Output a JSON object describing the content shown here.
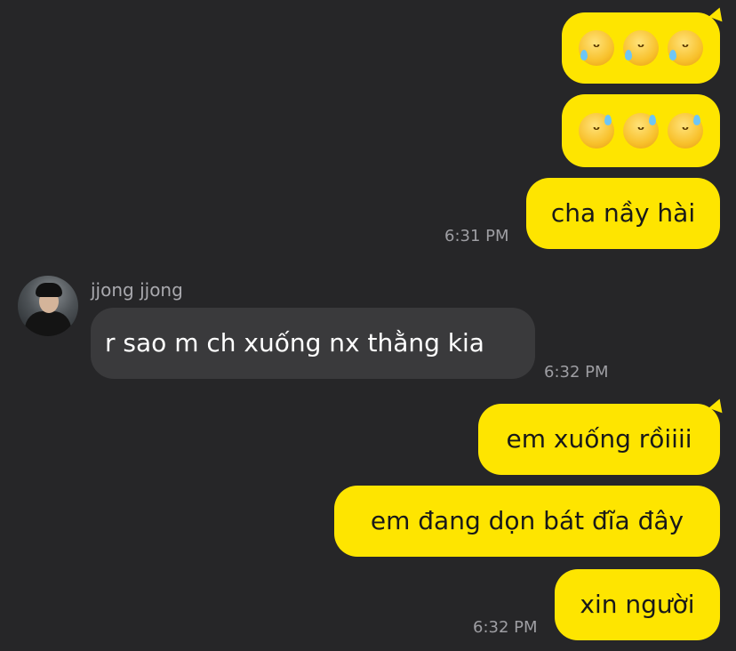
{
  "chat": {
    "outgoing_group_1": {
      "emoji_row_1": [
        "rolling-on-floor-laughing-emoji",
        "rolling-on-floor-laughing-emoji",
        "rolling-on-floor-laughing-emoji"
      ],
      "emoji_row_2": [
        "grinning-sweat-emoji",
        "grinning-sweat-emoji",
        "grinning-sweat-emoji"
      ],
      "message": "cha nầy hài",
      "time": "6:31 PM"
    },
    "incoming": {
      "sender": "jjong jjong",
      "message": "r sao m ch xuống nx thằng kia",
      "time": "6:32 PM"
    },
    "outgoing_group_2": {
      "message_1": "em xuống rồiiii",
      "message_2": "em đang dọn bát đĩa đây",
      "message_3": "xin người",
      "time": "6:32 PM"
    }
  },
  "colors": {
    "background": "#262628",
    "outgoing_bubble": "#FEE500",
    "incoming_bubble": "#3A3A3C",
    "timestamp": "#9E9EA3"
  }
}
